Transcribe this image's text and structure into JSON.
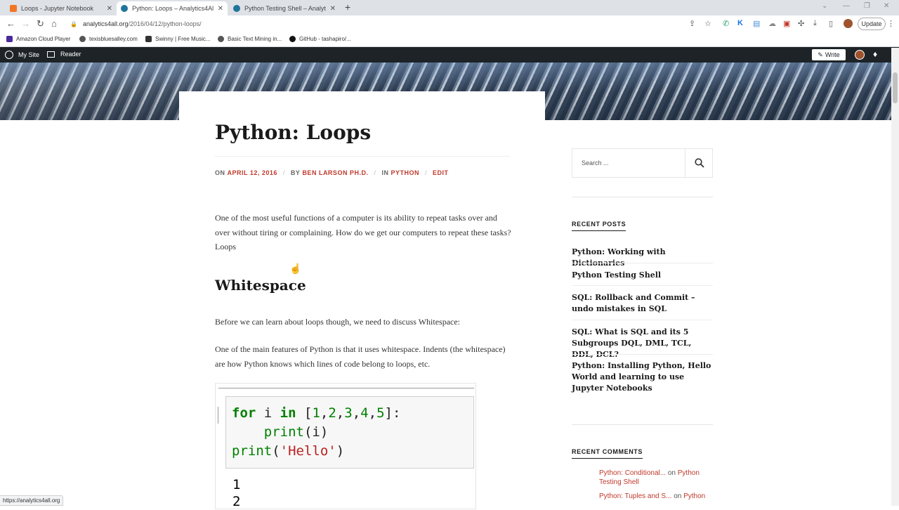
{
  "tabs": [
    {
      "title": "Loops - Jupyter Notebook",
      "color": "#f37626"
    },
    {
      "title": "Python: Loops – Analytics4All",
      "color": "#21759b"
    },
    {
      "title": "Python Testing Shell – Analytics4...",
      "color": "#21759b"
    }
  ],
  "address": {
    "host": "analytics4all.org",
    "path": "/2016/04/12/python-loops/"
  },
  "update_label": "Update",
  "bookmarks": [
    "Amazon Cloud Player",
    "texisbluesalley.com",
    "Swinny | Free Music...",
    "Basic Text Mining in...",
    "GitHub - tashapiro/..."
  ],
  "wpbar": {
    "my_site": "My Site",
    "reader": "Reader",
    "write": "Write"
  },
  "article": {
    "title": "Python: Loops",
    "meta": {
      "on": "ON",
      "date": "APRIL 12, 2016",
      "by": "BY",
      "author": "BEN LARSON PH.D.",
      "in": "IN",
      "category": "PYTHON",
      "edit": "EDIT"
    },
    "intro": "One of the most useful functions of a computer is its ability to repeat tasks over and over without tiring or complaining. How do we get our computers to repeat these tasks? Loops",
    "h2": "Whitespace",
    "p2": "Before we can learn about loops though, we need to discuss Whitespace:",
    "p3": "One of the main features of Python is that it uses whitespace. Indents (the whitespace) are how Python knows which lines of code belong to loops, etc.",
    "code_output": [
      "1",
      "2"
    ]
  },
  "sidebar": {
    "search_placeholder": "Search ...",
    "recent_posts_heading": "RECENT POSTS",
    "recent_posts": [
      "Python: Working with Dictionaries",
      "Python Testing Shell",
      "SQL: Rollback and Commit – undo mistakes in SQL",
      "SQL: What is SQL and its 5 Subgroups DQL, DML, TCL, DDL, DCL?",
      "Python: Installing Python, Hello World and learning to use Jupyter Notebooks"
    ],
    "recent_comments_heading": "RECENT COMMENTS",
    "comments": [
      {
        "author": "Python: Conditional...",
        "on": "on",
        "post": "Python Testing Shell"
      },
      {
        "author": "Python: Tuples and S...",
        "on": "on",
        "post": "Python"
      }
    ]
  },
  "status_url": "https://analytics4all.org"
}
